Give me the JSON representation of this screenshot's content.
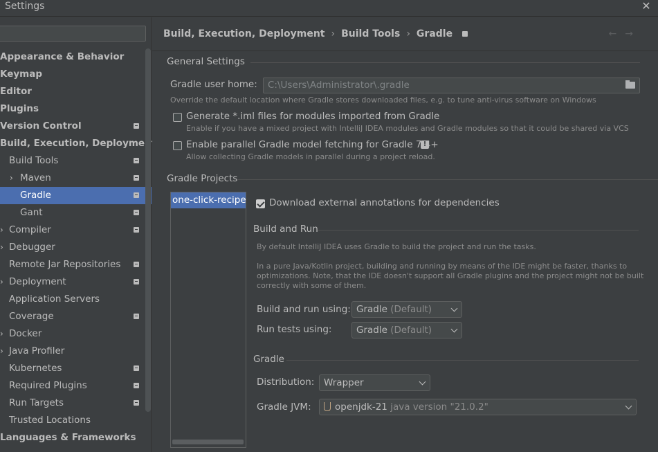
{
  "window": {
    "title": "Settings"
  },
  "sidebar": {
    "search_placeholder": "",
    "items": [
      {
        "label": "Appearance & Behavior",
        "level": 0,
        "bold": true,
        "arrow": false,
        "badge": false
      },
      {
        "label": "Keymap",
        "level": 0,
        "bold": true,
        "arrow": false,
        "badge": false
      },
      {
        "label": "Editor",
        "level": 0,
        "bold": true,
        "arrow": false,
        "badge": false
      },
      {
        "label": "Plugins",
        "level": 0,
        "bold": true,
        "arrow": false,
        "badge": false
      },
      {
        "label": "Version Control",
        "level": 0,
        "bold": true,
        "arrow": false,
        "badge": true
      },
      {
        "label": "Build, Execution, Deployment",
        "level": 0,
        "bold": true,
        "arrow": false,
        "badge": false
      },
      {
        "label": "Build Tools",
        "level": 1,
        "bold": false,
        "arrow": false,
        "badge": true
      },
      {
        "label": "Maven",
        "level": 2,
        "bold": false,
        "arrow": true,
        "badge": true
      },
      {
        "label": "Gradle",
        "level": 3,
        "bold": false,
        "arrow": false,
        "badge": true,
        "selected": true
      },
      {
        "label": "Gant",
        "level": 3,
        "bold": false,
        "arrow": false,
        "badge": true
      },
      {
        "label": "Compiler",
        "level": 1,
        "bold": false,
        "arrow": true,
        "badge": true
      },
      {
        "label": "Debugger",
        "level": 1,
        "bold": false,
        "arrow": true,
        "badge": false
      },
      {
        "label": "Remote Jar Repositories",
        "level": 1,
        "bold": false,
        "arrow": false,
        "badge": true
      },
      {
        "label": "Deployment",
        "level": 1,
        "bold": false,
        "arrow": true,
        "badge": true
      },
      {
        "label": "Application Servers",
        "level": 1,
        "bold": false,
        "arrow": false,
        "badge": false
      },
      {
        "label": "Coverage",
        "level": 1,
        "bold": false,
        "arrow": false,
        "badge": true
      },
      {
        "label": "Docker",
        "level": 1,
        "bold": false,
        "arrow": true,
        "badge": false
      },
      {
        "label": "Java Profiler",
        "level": 1,
        "bold": false,
        "arrow": true,
        "badge": false
      },
      {
        "label": "Kubernetes",
        "level": 1,
        "bold": false,
        "arrow": false,
        "badge": true
      },
      {
        "label": "Required Plugins",
        "level": 1,
        "bold": false,
        "arrow": false,
        "badge": true
      },
      {
        "label": "Run Targets",
        "level": 1,
        "bold": false,
        "arrow": false,
        "badge": true
      },
      {
        "label": "Trusted Locations",
        "level": 1,
        "bold": false,
        "arrow": false,
        "badge": false
      },
      {
        "label": "Languages & Frameworks",
        "level": 0,
        "bold": true,
        "arrow": false,
        "badge": false
      }
    ]
  },
  "breadcrumb": {
    "items": [
      "Build, Execution, Deployment",
      "Build Tools",
      "Gradle"
    ],
    "separator": "›"
  },
  "nav": {
    "back": "←",
    "forward": "→"
  },
  "general": {
    "title": "General Settings",
    "user_home_label": "Gradle user home:",
    "user_home_value": "C:\\Users\\Administrator\\.gradle",
    "user_home_hint": "Override the default location where Gradle stores downloaded files, e.g. to tune anti-virus software on Windows",
    "iml_label": "Generate *.iml files for modules imported from Gradle",
    "iml_checked": false,
    "iml_hint": "Enable if you have a mixed project with IntelliJ IDEA modules and Gradle modules so that it could be shared via VCS",
    "parallel_label": "Enable parallel Gradle model fetching for Gradle 7.4+",
    "parallel_checked": false,
    "parallel_hint": "Allow collecting Gradle models in parallel during a project reload.",
    "warn_glyph": "!"
  },
  "projects": {
    "title": "Gradle Projects",
    "list": [
      "one-click-recipe"
    ],
    "download_annotations_label": "Download external annotations for dependencies",
    "download_annotations_checked": true,
    "build_and_run": {
      "title": "Build and Run",
      "hint1": "By default IntelliJ IDEA uses Gradle to build the project and run the tasks.",
      "hint2_line1": "In a pure Java/Kotlin project, building and running by means of the IDE might be faster, thanks to",
      "hint2_line2": "optimizations. Note, that the IDE doesn't support all Gradle plugins and the project might not be built",
      "hint2_line3": "correctly with some of them.",
      "build_label": "Build and run using:",
      "build_value": "Gradle",
      "build_suffix": "(Default)",
      "tests_label": "Run tests using:",
      "tests_value": "Gradle",
      "tests_suffix": "(Default)"
    },
    "gradle": {
      "title": "Gradle",
      "distribution_label": "Distribution:",
      "distribution_value": "Wrapper",
      "jvm_label": "Gradle JVM:",
      "jvm_name": "openjdk-21",
      "jvm_version": "java version \"21.0.2\""
    }
  }
}
